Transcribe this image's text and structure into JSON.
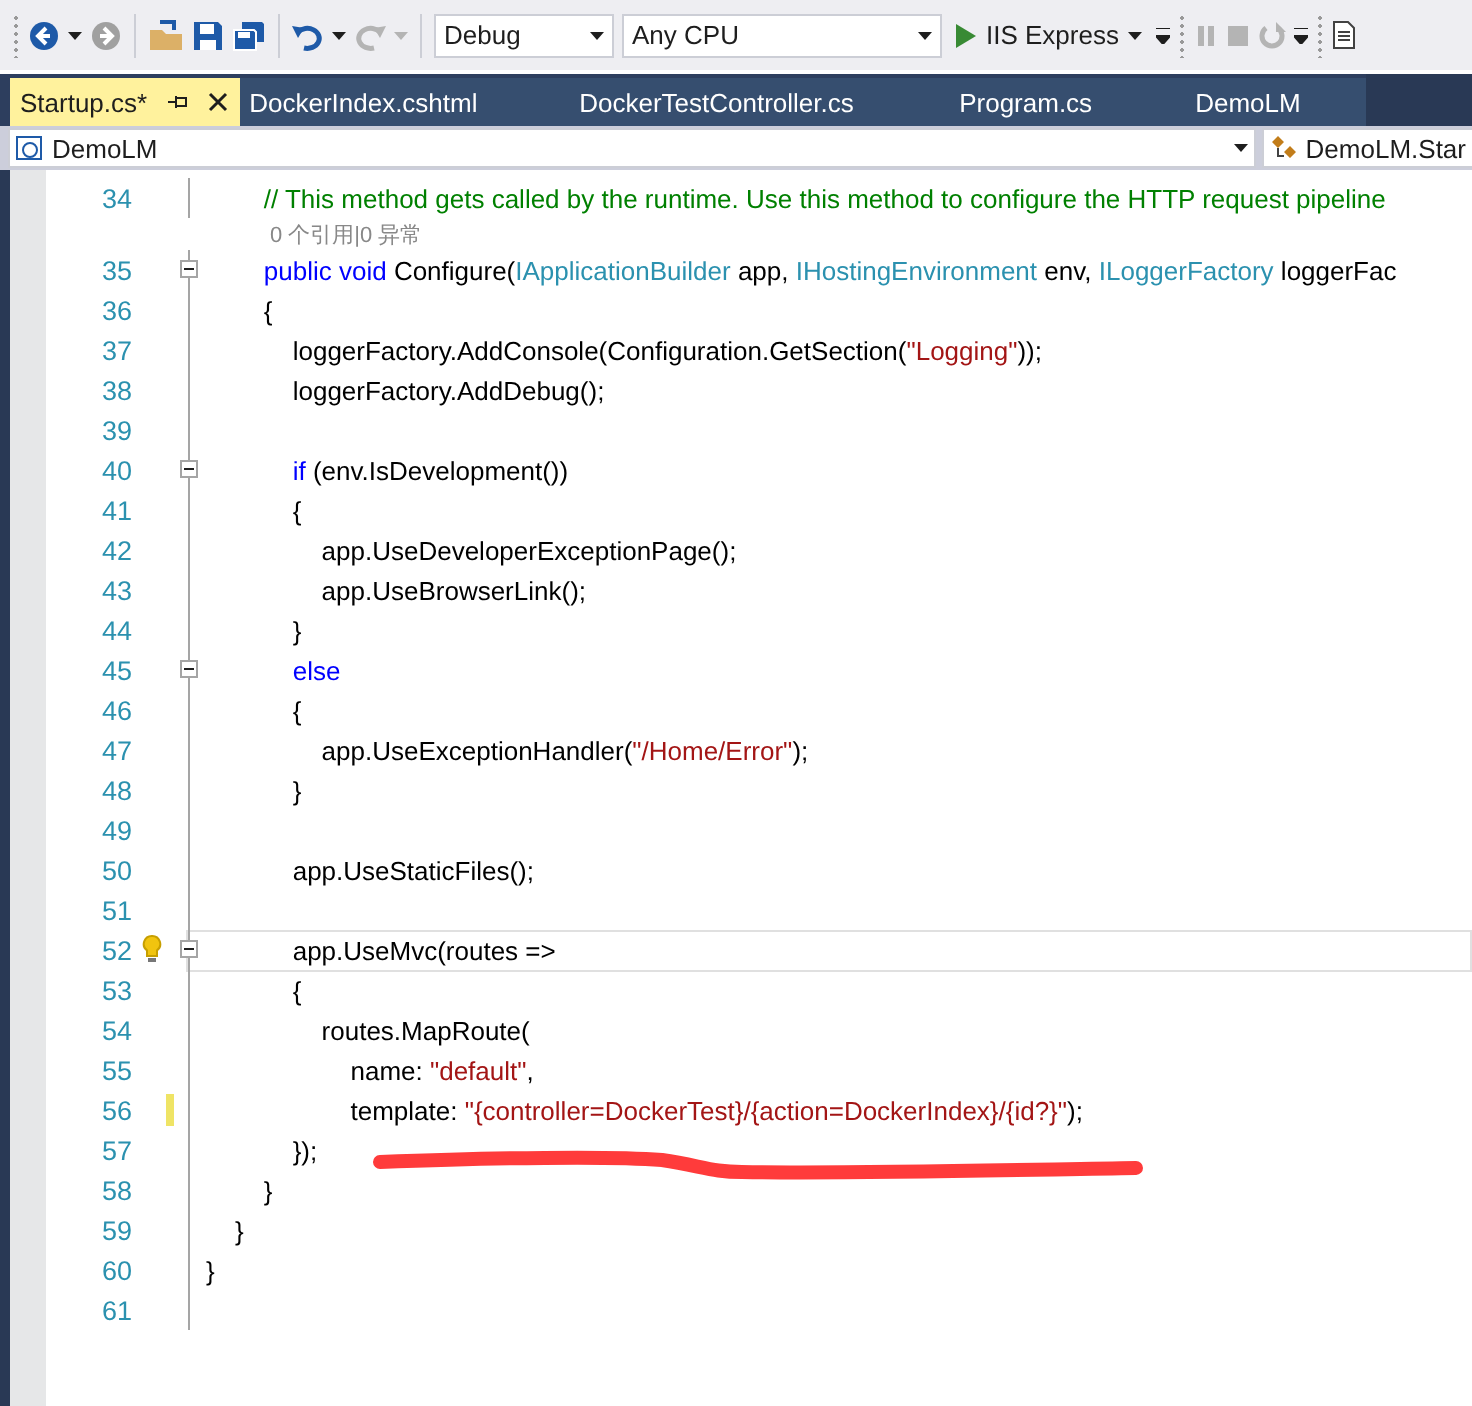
{
  "toolbar": {
    "configuration": "Debug",
    "platform": "Any CPU",
    "run_target": "IIS Express"
  },
  "tabs": [
    {
      "label": "Startup.cs*",
      "selected": true
    },
    {
      "label": "DockerIndex.cshtml",
      "selected": false
    },
    {
      "label": "DockerTestController.cs",
      "selected": false
    },
    {
      "label": "Program.cs",
      "selected": false
    },
    {
      "label": "DemoLM",
      "selected": false
    }
  ],
  "navigation_bar": {
    "project": "DemoLM",
    "member": "DemoLM.Star"
  },
  "code_lines": [
    {
      "number": "34",
      "tokens": [
        {
          "kind": "comment",
          "text": "        // This method gets called by the runtime. Use this method to configure the HTTP request pipeline"
        }
      ],
      "fold": false,
      "modified": false,
      "lightbulb": false,
      "current": false
    },
    {
      "number": "35",
      "codelens": "0 个引用|0 异常",
      "tokens": [
        {
          "kind": "keyword",
          "text": "        public void"
        },
        {
          "kind": "plain",
          "text": " Configure("
        },
        {
          "kind": "type",
          "text": "IApplicationBuilder"
        },
        {
          "kind": "plain",
          "text": " app, "
        },
        {
          "kind": "type",
          "text": "IHostingEnvironment"
        },
        {
          "kind": "plain",
          "text": " env, "
        },
        {
          "kind": "type",
          "text": "ILoggerFactory"
        },
        {
          "kind": "plain",
          "text": " loggerFac"
        }
      ],
      "fold": true,
      "modified": false,
      "lightbulb": false,
      "current": false
    },
    {
      "number": "36",
      "tokens": [
        {
          "kind": "plain",
          "text": "        {"
        }
      ],
      "fold": false,
      "modified": false,
      "lightbulb": false,
      "current": false
    },
    {
      "number": "37",
      "tokens": [
        {
          "kind": "plain",
          "text": "            loggerFactory.AddConsole(Configuration.GetSection("
        },
        {
          "kind": "string",
          "text": "\"Logging\""
        },
        {
          "kind": "plain",
          "text": "));"
        }
      ],
      "fold": false,
      "modified": false,
      "lightbulb": false,
      "current": false
    },
    {
      "number": "38",
      "tokens": [
        {
          "kind": "plain",
          "text": "            loggerFactory.AddDebug();"
        }
      ],
      "fold": false,
      "modified": false,
      "lightbulb": false,
      "current": false
    },
    {
      "number": "39",
      "fold": false,
      "modified": false,
      "lightbulb": false,
      "current": false
    },
    {
      "number": "40",
      "tokens": [
        {
          "kind": "keyword",
          "text": "            if"
        },
        {
          "kind": "plain",
          "text": " (env.IsDevelopment())"
        }
      ],
      "fold": true,
      "modified": false,
      "lightbulb": false,
      "current": false
    },
    {
      "number": "41",
      "tokens": [
        {
          "kind": "plain",
          "text": "            {"
        }
      ],
      "fold": false,
      "modified": false,
      "lightbulb": false,
      "current": false
    },
    {
      "number": "42",
      "tokens": [
        {
          "kind": "plain",
          "text": "                app.UseDeveloperExceptionPage();"
        }
      ],
      "fold": false,
      "modified": false,
      "lightbulb": false,
      "current": false
    },
    {
      "number": "43",
      "tokens": [
        {
          "kind": "plain",
          "text": "                app.UseBrowserLink();"
        }
      ],
      "fold": false,
      "modified": false,
      "lightbulb": false,
      "current": false
    },
    {
      "number": "44",
      "tokens": [
        {
          "kind": "plain",
          "text": "            }"
        }
      ],
      "fold": false,
      "modified": false,
      "lightbulb": false,
      "current": false
    },
    {
      "number": "45",
      "tokens": [
        {
          "kind": "keyword",
          "text": "            else"
        }
      ],
      "fold": true,
      "modified": false,
      "lightbulb": false,
      "current": false
    },
    {
      "number": "46",
      "tokens": [
        {
          "kind": "plain",
          "text": "            {"
        }
      ],
      "fold": false,
      "modified": false,
      "lightbulb": false,
      "current": false
    },
    {
      "number": "47",
      "tokens": [
        {
          "kind": "plain",
          "text": "                app.UseExceptionHandler("
        },
        {
          "kind": "string",
          "text": "\"/Home/Error\""
        },
        {
          "kind": "plain",
          "text": ");"
        }
      ],
      "fold": false,
      "modified": false,
      "lightbulb": false,
      "current": false
    },
    {
      "number": "48",
      "tokens": [
        {
          "kind": "plain",
          "text": "            }"
        }
      ],
      "fold": false,
      "modified": false,
      "lightbulb": false,
      "current": false
    },
    {
      "number": "49",
      "fold": false,
      "modified": false,
      "lightbulb": false,
      "current": false
    },
    {
      "number": "50",
      "tokens": [
        {
          "kind": "plain",
          "text": "            app.UseStaticFiles();"
        }
      ],
      "fold": false,
      "modified": false,
      "lightbulb": false,
      "current": false
    },
    {
      "number": "51",
      "fold": false,
      "modified": false,
      "lightbulb": false,
      "current": false
    },
    {
      "number": "52",
      "tokens": [
        {
          "kind": "plain",
          "text": "            app.UseMvc(routes =>"
        }
      ],
      "fold": true,
      "modified": false,
      "lightbulb": true,
      "current": true
    },
    {
      "number": "53",
      "tokens": [
        {
          "kind": "plain",
          "text": "            {"
        }
      ],
      "fold": false,
      "modified": false,
      "lightbulb": false,
      "current": false
    },
    {
      "number": "54",
      "tokens": [
        {
          "kind": "plain",
          "text": "                routes.MapRoute("
        }
      ],
      "fold": false,
      "modified": false,
      "lightbulb": false,
      "current": false
    },
    {
      "number": "55",
      "tokens": [
        {
          "kind": "plain",
          "text": "                    name: "
        },
        {
          "kind": "string",
          "text": "\"default\""
        },
        {
          "kind": "plain",
          "text": ","
        }
      ],
      "fold": false,
      "modified": false,
      "lightbulb": false,
      "current": false
    },
    {
      "number": "56",
      "tokens": [
        {
          "kind": "plain",
          "text": "                    template: "
        },
        {
          "kind": "string",
          "text": "\"{controller=DockerTest}/{action=DockerIndex}/{id?}\""
        },
        {
          "kind": "plain",
          "text": ");"
        }
      ],
      "fold": false,
      "modified": true,
      "lightbulb": false,
      "current": false
    },
    {
      "number": "57",
      "tokens": [
        {
          "kind": "plain",
          "text": "            });"
        }
      ],
      "fold": false,
      "modified": false,
      "lightbulb": false,
      "current": false
    },
    {
      "number": "58",
      "tokens": [
        {
          "kind": "plain",
          "text": "        }"
        }
      ],
      "fold": false,
      "modified": false,
      "lightbulb": false,
      "current": false
    },
    {
      "number": "59",
      "tokens": [
        {
          "kind": "plain",
          "text": "    }"
        }
      ],
      "fold": false,
      "modified": false,
      "lightbulb": false,
      "current": false
    },
    {
      "number": "60",
      "tokens": [
        {
          "kind": "plain",
          "text": "}"
        }
      ],
      "fold": false,
      "modified": false,
      "lightbulb": false,
      "current": false
    },
    {
      "number": "61",
      "fold": false,
      "modified": false,
      "lightbulb": false,
      "current": false
    }
  ]
}
